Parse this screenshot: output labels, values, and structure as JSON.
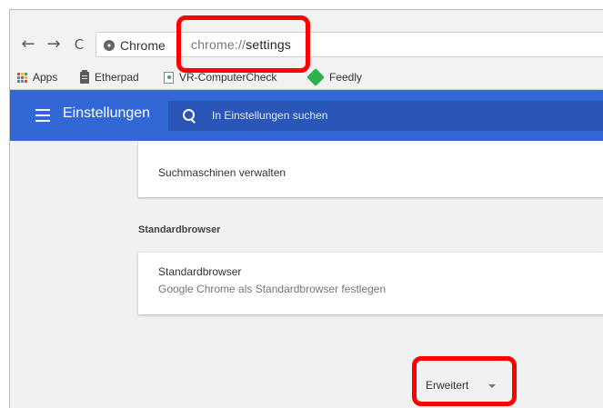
{
  "toolbar": {
    "back_glyph": "←",
    "forward_glyph": "→",
    "reload_glyph": "C",
    "site_name": "Chrome",
    "url_scheme": "chrome://",
    "url_path": "settings"
  },
  "bookmarks": [
    {
      "label": "Apps",
      "icon": "apps-grid-icon"
    },
    {
      "label": "Etherpad",
      "icon": "clipboard-icon"
    },
    {
      "label": "VR-ComputerCheck",
      "icon": "page-icon"
    },
    {
      "label": "Feedly",
      "icon": "feedly-icon"
    }
  ],
  "header": {
    "title": "Einstellungen",
    "search_placeholder": "In Einstellungen suchen"
  },
  "content": {
    "search_engines_label": "Suchmaschinen verwalten",
    "default_browser_section": "Standardbrowser",
    "default_browser_title": "Standardbrowser",
    "default_browser_subtitle": "Google Chrome als Standardbrowser festlegen",
    "advanced_label": "Erweitert"
  },
  "colors": {
    "header": "#3367d6",
    "highlight": "#ff0000",
    "feedly": "#2bb24c"
  }
}
